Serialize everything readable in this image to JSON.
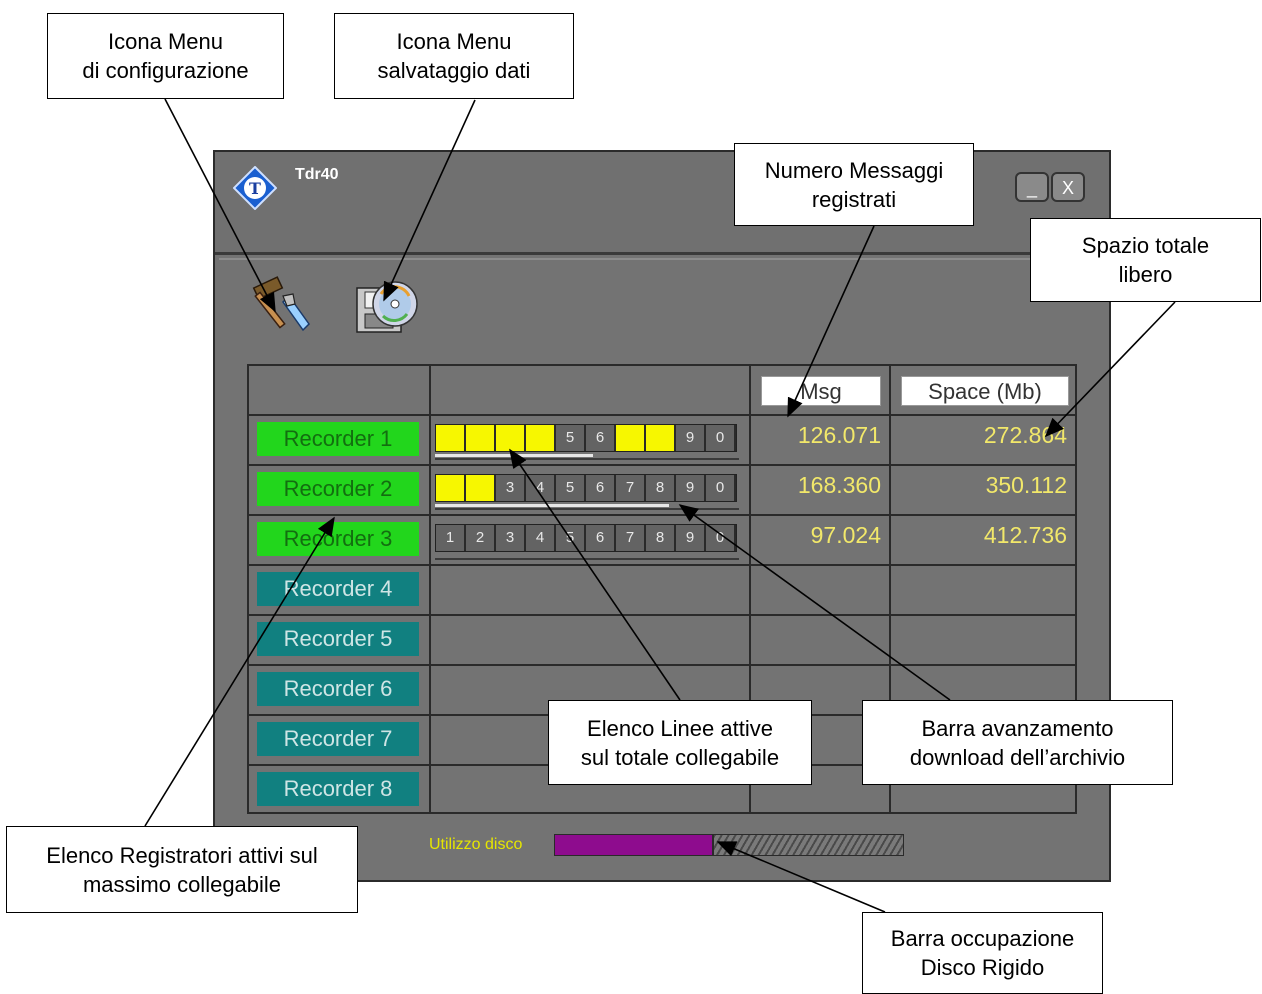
{
  "window": {
    "title": "Tdr40",
    "logo_letter": "T",
    "min_label": "_",
    "close_label": "X"
  },
  "toolbar": {
    "config_icon": "tools-icon",
    "save_icon": "disk-save-icon"
  },
  "grid": {
    "msg_header": "Msg",
    "space_header": "Space (Mb)",
    "recorders": [
      {
        "label": "Recorder 1",
        "active": true,
        "lines": [
          "",
          "",
          "",
          "",
          "5",
          "6",
          "",
          "",
          "9",
          "0"
        ],
        "lines_on": [
          1,
          1,
          1,
          1,
          0,
          0,
          1,
          1,
          0,
          0
        ],
        "download_progress": 0.52,
        "msg": "126.071",
        "space": "272.864"
      },
      {
        "label": "Recorder 2",
        "active": true,
        "lines": [
          "",
          "",
          "3",
          "4",
          "5",
          "6",
          "7",
          "8",
          "9",
          "0"
        ],
        "lines_on": [
          1,
          1,
          0,
          0,
          0,
          0,
          0,
          0,
          0,
          0
        ],
        "download_progress": 0.77,
        "msg": "168.360",
        "space": "350.112"
      },
      {
        "label": "Recorder 3",
        "active": true,
        "lines": [
          "1",
          "2",
          "3",
          "4",
          "5",
          "6",
          "7",
          "8",
          "9",
          "0"
        ],
        "lines_on": [
          0,
          0,
          0,
          0,
          0,
          0,
          0,
          0,
          0,
          0
        ],
        "download_progress": 0,
        "msg": "97.024",
        "space": "412.736"
      },
      {
        "label": "Recorder 4",
        "active": false
      },
      {
        "label": "Recorder 5",
        "active": false
      },
      {
        "label": "Recorder 6",
        "active": false
      },
      {
        "label": "Recorder 7",
        "active": false
      },
      {
        "label": "Recorder 8",
        "active": false
      }
    ]
  },
  "disk": {
    "label": "Utilizzo disco",
    "usage": 0.45
  },
  "colors": {
    "active_recorder": "#22d61c",
    "inactive_recorder": "#118080",
    "line_on": "#f7f700",
    "disk_fill": "#8e0c8e",
    "value_text": "#f2e86a"
  },
  "callouts": {
    "config_menu": [
      "Icona Menu",
      "di configurazione"
    ],
    "save_menu": [
      "Icona Menu",
      "salvataggio dati"
    ],
    "msg_count": [
      "Numero Messaggi",
      "registrati"
    ],
    "free_space": [
      "Spazio totale",
      "libero"
    ],
    "active_lines": [
      "Elenco Linee attive",
      "sul totale collegabile"
    ],
    "download_bar": [
      "Barra avanzamento",
      "download dell’archivio"
    ],
    "active_recorders": [
      "Elenco Registratori attivi sul",
      "massimo collegabile"
    ],
    "disk_bar": [
      "Barra occupazione",
      "Disco Rigido"
    ]
  }
}
